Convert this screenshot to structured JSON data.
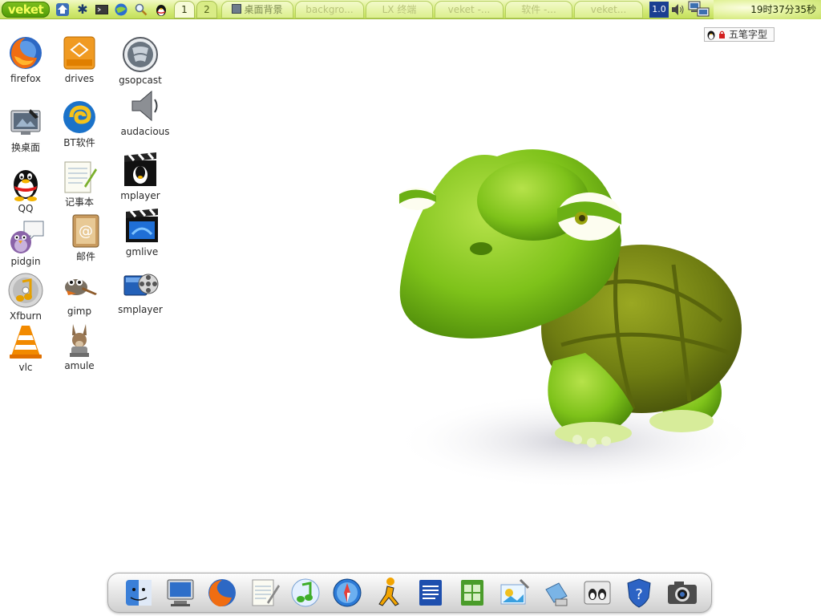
{
  "taskbar": {
    "start_label": "veket",
    "launchers": [
      {
        "name": "home-icon"
      },
      {
        "name": "settings-star-icon"
      },
      {
        "name": "terminal-icon"
      },
      {
        "name": "browser-globe-icon"
      },
      {
        "name": "find-icon"
      },
      {
        "name": "qq-penguin-icon"
      }
    ],
    "workspaces": [
      "1",
      "2"
    ],
    "tasks": [
      "桌面背景",
      "backgro...",
      "LX 终端",
      "veket -...",
      "软件 -...",
      "veket..."
    ],
    "version_badge": "1.0",
    "clock": "19时37分35秒"
  },
  "ime": {
    "label": "五笔字型"
  },
  "desktop_icons": [
    {
      "label": "firefox",
      "icon": "firefox-icon"
    },
    {
      "label": "drives",
      "icon": "drives-icon"
    },
    {
      "label": "gsopcast",
      "icon": "gsopcast-icon"
    },
    {
      "label": "换桌面",
      "icon": "wallpaper-changer-icon"
    },
    {
      "label": "BT软件",
      "icon": "bittorrent-icon"
    },
    {
      "label": "audacious",
      "icon": "speaker-icon"
    },
    {
      "label": "QQ",
      "icon": "qq-icon"
    },
    {
      "label": "记事本",
      "icon": "notepad-icon"
    },
    {
      "label": "mplayer",
      "icon": "mplayer-icon"
    },
    {
      "label": "pidgin",
      "icon": "pidgin-icon"
    },
    {
      "label": "邮件",
      "icon": "mail-icon"
    },
    {
      "label": "gmlive",
      "icon": "gmlive-icon"
    },
    {
      "label": "Xfburn",
      "icon": "xfburn-icon"
    },
    {
      "label": "gimp",
      "icon": "gimp-icon"
    },
    {
      "label": "smplayer",
      "icon": "smplayer-icon"
    },
    {
      "label": "vlc",
      "icon": "vlc-icon"
    },
    {
      "label": "amule",
      "icon": "amule-icon"
    }
  ],
  "dock": {
    "items": [
      "finder-icon",
      "monitor-icon",
      "firefox-icon",
      "text-editor-icon",
      "itunes-icon",
      "safari-icon",
      "aim-icon",
      "document-icon",
      "spreadsheet-icon",
      "image-editor-icon",
      "usb-icon",
      "linux-settings-icon",
      "security-shield-icon",
      "camera-icon"
    ]
  },
  "colors": {
    "taskbar_green": "#d6ec7c",
    "start_green": "#4f9a06",
    "start_text": "#f4ff5a",
    "version_blue": "#1a3f91",
    "turtle_green": "#7ec21a",
    "shell_olive": "#6f7d12"
  }
}
